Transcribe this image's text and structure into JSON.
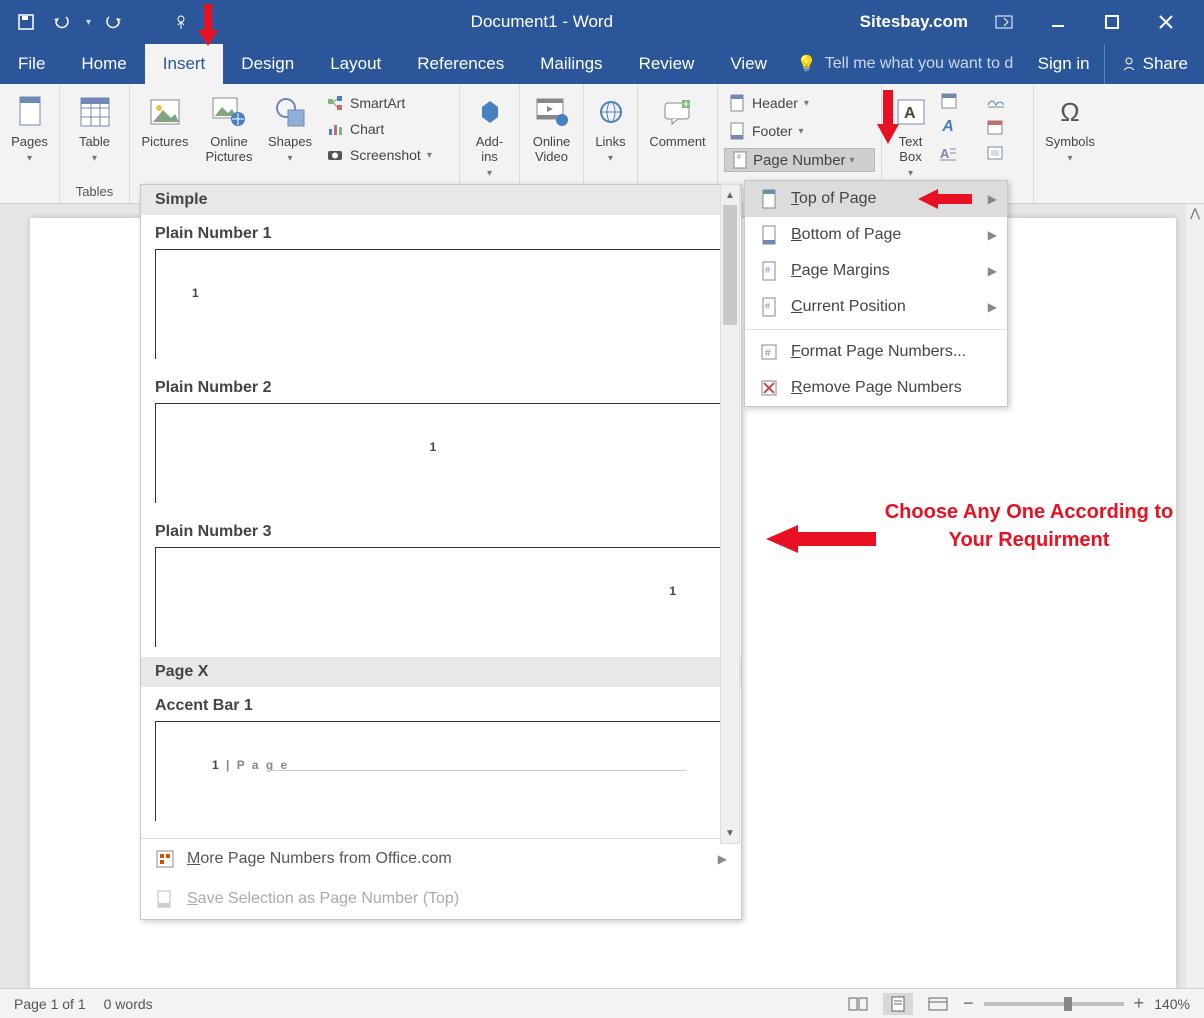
{
  "title": "Document1 - Word",
  "site_label": "Sitesbay.com",
  "tabs": {
    "file": "File",
    "home": "Home",
    "insert": "Insert",
    "design": "Design",
    "layout": "Layout",
    "references": "References",
    "mailings": "Mailings",
    "review": "Review",
    "view": "View"
  },
  "tellme_placeholder": "Tell me what you want to d",
  "signin": "Sign in",
  "share": "Share",
  "ribbon": {
    "pages": {
      "label": "Pages",
      "group": ""
    },
    "table": {
      "label": "Table",
      "group": "Tables"
    },
    "pictures": "Pictures",
    "online_pictures": "Online Pictures",
    "shapes": "Shapes",
    "smartart": "SmartArt",
    "chart": "Chart",
    "screenshot": "Screenshot",
    "addins": "Add-ins",
    "online_video": "Online Video",
    "links": "Links",
    "comment": "Comment",
    "header": "Header",
    "footer": "Footer",
    "page_number": "Page Number",
    "text_box": "Text Box",
    "symbols": "Symbols"
  },
  "flyout": {
    "top": "Top of Page",
    "bottom": "Bottom of Page",
    "margins": "Page Margins",
    "current": "Current Position",
    "format": "Format Page Numbers...",
    "remove": "Remove Page Numbers"
  },
  "gallery": {
    "section1": "Simple",
    "plain1": "Plain Number 1",
    "plain2": "Plain Number 2",
    "plain3": "Plain Number 3",
    "section2": "Page X",
    "accent1": "Accent Bar 1",
    "accent1_text": "1 | P a g e",
    "more": "More Page Numbers from Office.com",
    "save_sel": "Save Selection as Page Number (Top)"
  },
  "annotation_text": "Choose Any One According to Your Requirment",
  "status": {
    "pages": "Page 1 of 1",
    "words": "0 words",
    "zoom": "140%"
  }
}
